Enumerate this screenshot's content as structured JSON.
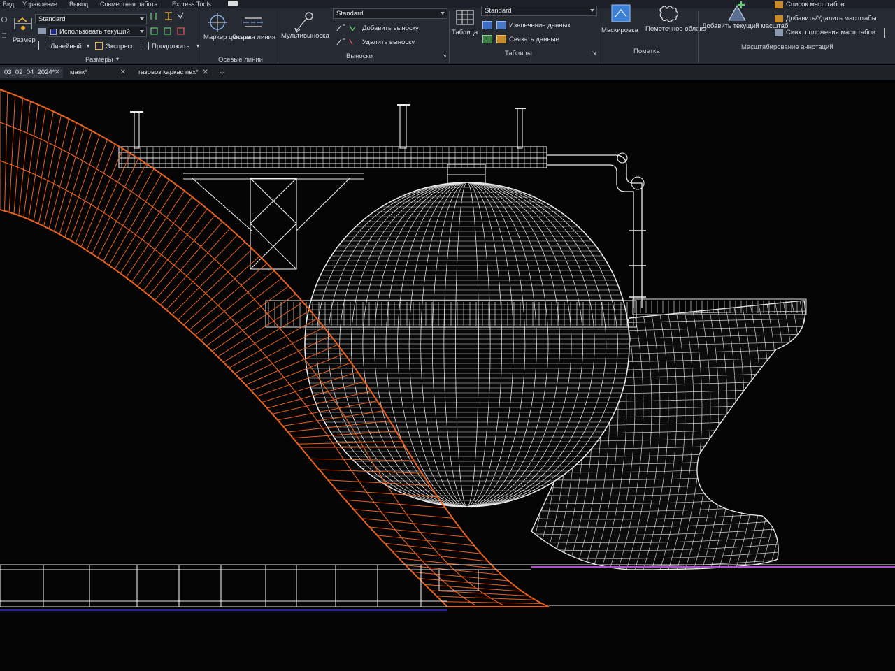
{
  "menu": {
    "items": [
      "Вид",
      "Управление",
      "Вывод",
      "Совместная работа",
      "Express Tools"
    ]
  },
  "ribbon": {
    "razmery": {
      "size_button": "Размер",
      "style_value": "Standard",
      "layer_value": "Использовать текущий",
      "linear_label": "Линейный",
      "express_label": "Экспресс",
      "continue_label": "Продолжить",
      "title": "Размеры"
    },
    "osevye": {
      "center_mark_label": "Маркер центра",
      "center_line_label": "Осевая линия",
      "title": "Осевые линии"
    },
    "vynoski": {
      "multileader_label": "Мультивыноска",
      "style_value": "Standard",
      "add_leader_label": "Добавить выноску",
      "remove_leader_label": "Удалить выноску",
      "title": "Выноски"
    },
    "tablicy": {
      "table_label": "Таблица",
      "style_value": "Standard",
      "extract_label": "Извлечение данных",
      "link_label": "Связать данные",
      "title": "Таблицы"
    },
    "pometka": {
      "mask_label": "Маскировка",
      "cloud_label": "Пометочное облако",
      "title": "Пометка"
    },
    "annot": {
      "add_scale_label": "Добавить текущий масштаб",
      "scale_list_label": "Список масштабов",
      "add_remove_label": "Добавить/Удалить масштабы",
      "sync_label": "Синх. положения масштабов",
      "title": "Масштабирование аннотаций"
    }
  },
  "tabs": [
    {
      "label": "03_02_04_2024*"
    },
    {
      "label": "маяк*"
    },
    {
      "label": "газовоз каркас пвх*"
    }
  ],
  "colors": {
    "accent_orange": "#e8621e",
    "wire_white": "#e9e9e9",
    "purple_line": "#b24fd0",
    "ribbon_bg": "#262a33"
  }
}
